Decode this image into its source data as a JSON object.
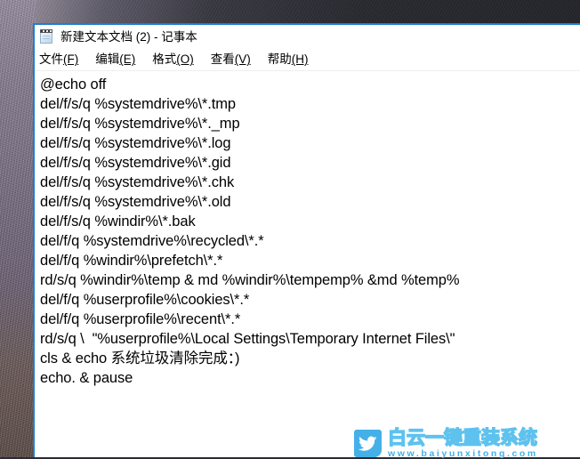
{
  "desktop": {
    "wallpaper_description": "dark textured concrete wallpaper"
  },
  "window": {
    "app": "notepad",
    "title": "新建文本文档 (2) - 记事本",
    "icon": "notepad-icon",
    "border_color": "#1a7fd2",
    "background_color": "#ffffff",
    "menu": [
      {
        "label": "文件",
        "accel": "(F)"
      },
      {
        "label": "编辑",
        "accel": "(E)"
      },
      {
        "label": "格式",
        "accel": "(O)"
      },
      {
        "label": "查看",
        "accel": "(V)"
      },
      {
        "label": "帮助",
        "accel": "(H)"
      }
    ],
    "document": {
      "lines": [
        "@echo off",
        "del/f/s/q %systemdrive%\\*.tmp",
        "del/f/s/q %systemdrive%\\*._mp",
        "del/f/s/q %systemdrive%\\*.log",
        "del/f/s/q %systemdrive%\\*.gid",
        "del/f/s/q %systemdrive%\\*.chk",
        "del/f/s/q %systemdrive%\\*.old",
        "del/f/s/q %windir%\\*.bak",
        "del/f/q %systemdrive%\\recycled\\*.*",
        "del/f/q %windir%\\prefetch\\*.*",
        "rd/s/q %windir%\\temp & md %windir%\\tempemp% &md %temp%",
        "del/f/q %userprofile%\\cookies\\*.*",
        "del/f/q %userprofile%\\recent\\*.*",
        "rd/s/q \\  \"%userprofile%\\Local Settings\\Temporary Internet Files\\\"",
        "cls & echo 系统垃圾清除完成：)",
        "echo. & pause"
      ]
    }
  },
  "watermark": {
    "icon": "twitter-bird-icon",
    "title": "白云一键重装系统",
    "url": "www.baiyunxitong.com",
    "color": "#45b0e8"
  }
}
